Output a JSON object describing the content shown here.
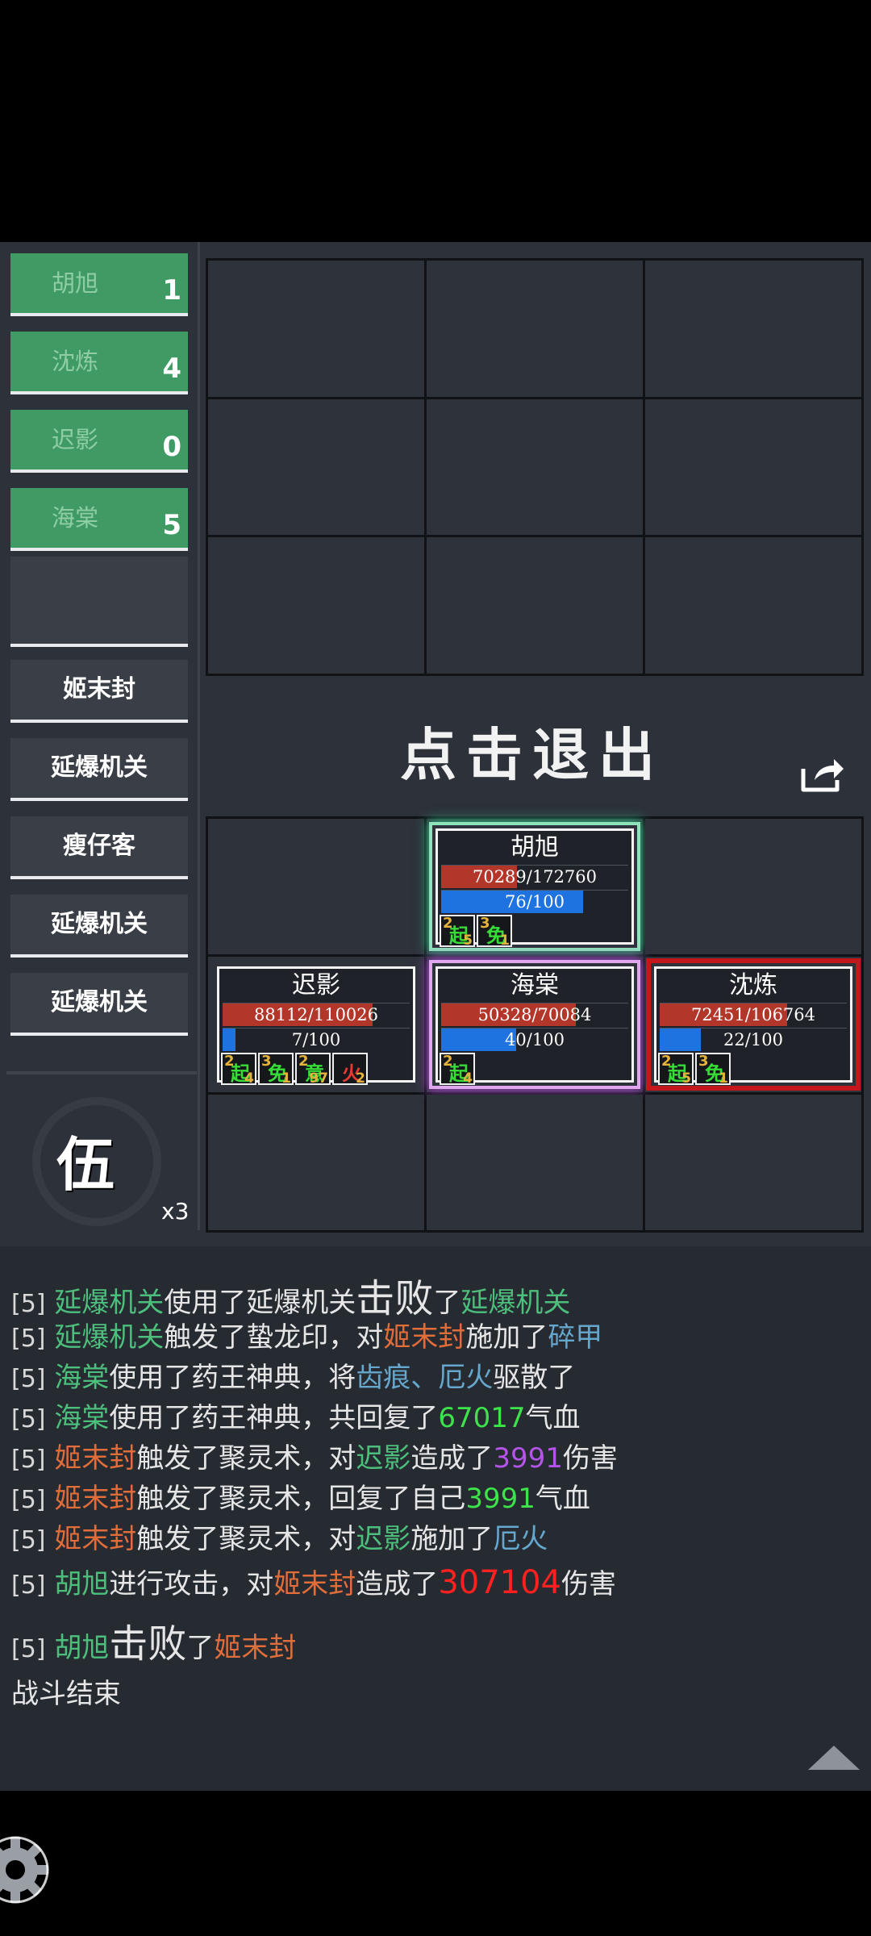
{
  "allies": [
    {
      "name": "胡旭",
      "count": "1"
    },
    {
      "name": "沈炼",
      "count": "4"
    },
    {
      "name": "迟影",
      "count": "0"
    },
    {
      "name": "海棠",
      "count": "5"
    }
  ],
  "enemies": [
    "姬末封",
    "延爆机关",
    "瘦仔客",
    "延爆机关",
    "延爆机关"
  ],
  "round": {
    "char": "伍",
    "multiplier": "x3"
  },
  "exit_text": "点击退出",
  "units": {
    "huxu": {
      "name": "胡旭",
      "hp_text": "70289/172760",
      "hp_frac": 0.407,
      "mp_text": "76/100",
      "mp_frac": 0.76,
      "buffs": [
        {
          "level": "2",
          "char": "起",
          "count": "5"
        },
        {
          "level": "3",
          "char": "免",
          "count": "1"
        }
      ]
    },
    "chiying": {
      "name": "迟影",
      "hp_text": "88112/110026",
      "hp_frac": 0.801,
      "mp_text": "7/100",
      "mp_frac": 0.07,
      "buffs": [
        {
          "level": "2",
          "char": "起",
          "count": "4"
        },
        {
          "level": "3",
          "char": "免",
          "count": "1"
        },
        {
          "level": "2",
          "char": "意",
          "count": "97"
        },
        {
          "level": "",
          "char": "火",
          "count": "2"
        }
      ]
    },
    "haitang": {
      "name": "海棠",
      "hp_text": "50328/70084",
      "hp_frac": 0.718,
      "mp_text": "40/100",
      "mp_frac": 0.4,
      "buffs": [
        {
          "level": "2",
          "char": "起",
          "count": "4"
        }
      ]
    },
    "shenlian": {
      "name": "沈炼",
      "hp_text": "72451/106764",
      "hp_frac": 0.679,
      "mp_text": "22/100",
      "mp_frac": 0.22,
      "buffs": [
        {
          "level": "2",
          "char": "起",
          "count": "5"
        },
        {
          "level": "3",
          "char": "免",
          "count": "1"
        }
      ]
    }
  },
  "log": {
    "round_tag": "[5]",
    "l1": {
      "a": "延爆机关",
      "b": "使用了延爆机关",
      "c": "击败",
      "d": "了",
      "e": "延爆机关"
    },
    "l2": {
      "a": "延爆机关",
      "b": "触发了蛰龙印，对",
      "c": "姬末封",
      "d": "施加了",
      "e": "碎甲"
    },
    "l3": {
      "a": "海棠",
      "b": "使用了药王神典，将",
      "c": "齿痕、厄火",
      "d": "驱散了"
    },
    "l4": {
      "a": "海棠",
      "b": "使用了药王神典，共回复了",
      "c": "67017",
      "d": "气血"
    },
    "l5": {
      "a": "姬末封",
      "b": "触发了聚灵术，对",
      "c": "迟影",
      "d": "造成了",
      "e": "3991",
      "f": "伤害"
    },
    "l6": {
      "a": "姬末封",
      "b": "触发了聚灵术，回复了自己",
      "c": "3991",
      "d": "气血"
    },
    "l7": {
      "a": "姬末封",
      "b": "触发了聚灵术，对",
      "c": "迟影",
      "d": "施加了",
      "e": "厄火"
    },
    "l8": {
      "a": "胡旭",
      "b": "进行攻击，对",
      "c": "姬末封",
      "d": "造成了",
      "e": "307104",
      "f": "伤害"
    },
    "l9": {
      "a": "胡旭",
      "b": "击败",
      "c": "了",
      "d": "姬末封"
    },
    "end": "战斗结束"
  },
  "colors": {
    "ally_green": "#3f9b63",
    "hp": "#b3362a",
    "mp": "#1f73e0",
    "accent_red": "#c3171b"
  }
}
